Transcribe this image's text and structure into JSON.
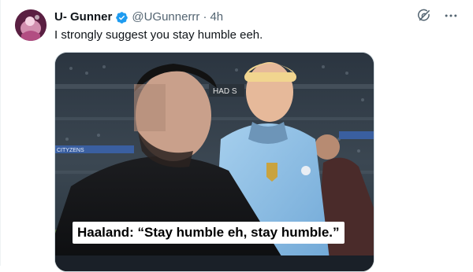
{
  "tweet": {
    "display_name": "U- Gunner",
    "handle": "@UGunnerrr",
    "separator": "·",
    "time": "4h",
    "text": "I strongly suggest you stay humble eeh.",
    "verified_color": "#1d9bf0"
  },
  "media": {
    "caption": "Haaland: “Stay humble eh, stay humble.”",
    "stadium_sign": "HAD S",
    "board_text": "CITYZENS"
  },
  "icons": {
    "grok": "grok-icon",
    "more": "more-icon",
    "verified": "verified-badge-icon"
  }
}
